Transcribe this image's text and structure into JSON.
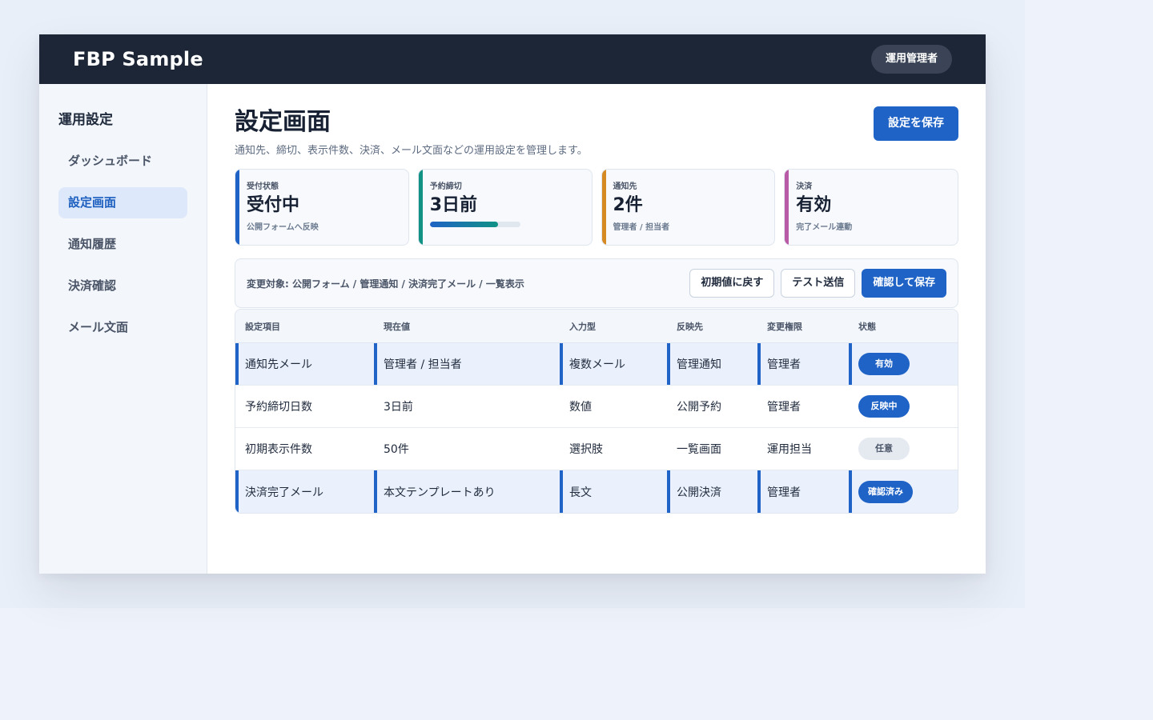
{
  "header": {
    "brand": "FBP Sample",
    "user_role": "運用管理者"
  },
  "sidebar": {
    "title": "運用設定",
    "items": [
      {
        "label": "ダッシュボード",
        "active": false
      },
      {
        "label": "設定画面",
        "active": true
      },
      {
        "label": "通知履歴",
        "active": false
      },
      {
        "label": "決済確認",
        "active": false
      },
      {
        "label": "メール文面",
        "active": false
      }
    ]
  },
  "main": {
    "title": "設定画面",
    "description": "通知先、締切、表示件数、決済、メール文面などの運用設定を管理します。",
    "save_button": "設定を保存"
  },
  "stats": [
    {
      "label": "受付状態",
      "value": "受付中",
      "sub": "公開フォームへ反映",
      "accent": "#1f63c6"
    },
    {
      "label": "予約締切",
      "value": "3日前",
      "sub": "",
      "accent": "#119285",
      "progress_percent": 75
    },
    {
      "label": "通知先",
      "value": "2件",
      "sub": "管理者 / 担当者",
      "accent": "#d68a24"
    },
    {
      "label": "決済",
      "value": "有効",
      "sub": "完了メール連動",
      "accent": "#b95aa6"
    }
  ],
  "toolbar": {
    "target_text": "変更対象: 公開フォーム / 管理通知 / 決済完了メール / 一覧表示",
    "reset_button": "初期値に戻す",
    "test_button": "テスト送信",
    "confirm_button": "確認して保存"
  },
  "table": {
    "columns": [
      "設定項目",
      "現在値",
      "入力型",
      "反映先",
      "変更権限",
      "状態"
    ],
    "rows": [
      {
        "cells": [
          "通知先メール",
          "管理者 / 担当者",
          "複数メール",
          "管理通知",
          "管理者"
        ],
        "status": "有効",
        "status_style": "blue",
        "highlight": true
      },
      {
        "cells": [
          "予約締切日数",
          "3日前",
          "数値",
          "公開予約",
          "管理者"
        ],
        "status": "反映中",
        "status_style": "blue",
        "highlight": false
      },
      {
        "cells": [
          "初期表示件数",
          "50件",
          "選択肢",
          "一覧画面",
          "運用担当"
        ],
        "status": "任意",
        "status_style": "gray",
        "highlight": false
      },
      {
        "cells": [
          "決済完了メール",
          "本文テンプレートあり",
          "長文",
          "公開決済",
          "管理者"
        ],
        "status": "確認済み",
        "status_style": "blue",
        "highlight": true
      }
    ]
  }
}
